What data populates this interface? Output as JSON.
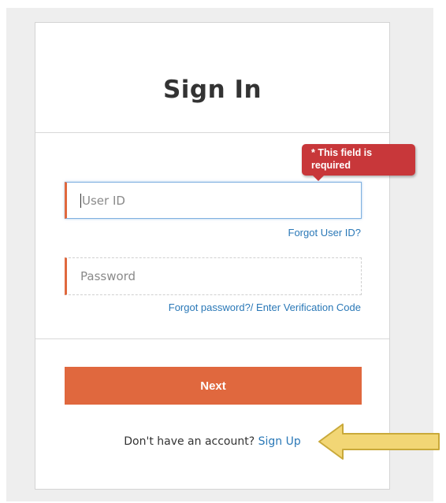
{
  "card": {
    "title": "Sign In"
  },
  "validation": {
    "tooltip_text": "* This field is required"
  },
  "form": {
    "user_id": {
      "value": "",
      "placeholder": "User ID",
      "forgot_link": "Forgot User ID?"
    },
    "password": {
      "value": "",
      "placeholder": "Password",
      "forgot_link": "Forgot password?/ Enter Verification Code"
    },
    "next_label": "Next"
  },
  "signup": {
    "prompt": "Don't have an account?",
    "link_label": "Sign Up"
  },
  "colors": {
    "accent": "#e0683e",
    "link": "#2a78b7",
    "error": "#c8373a",
    "arrow": "#f2d675"
  },
  "icons": {
    "annotation": "arrow-left-icon"
  }
}
